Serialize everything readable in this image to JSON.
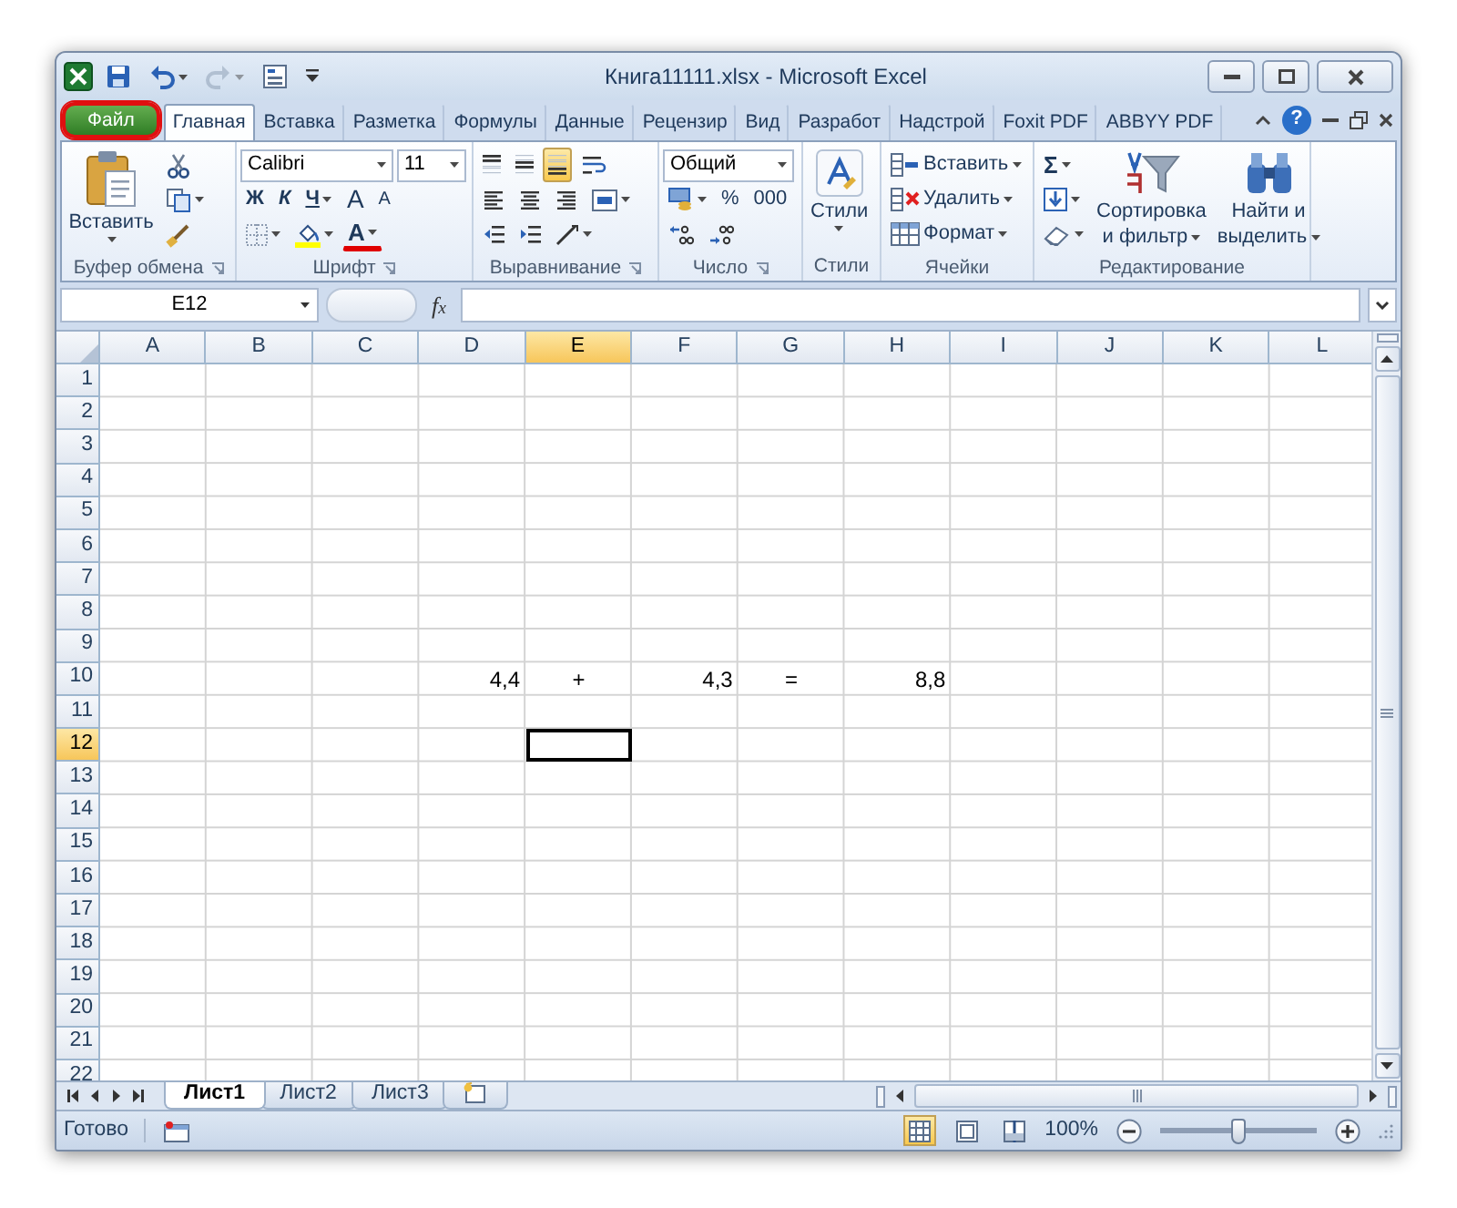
{
  "window": {
    "title": "Книга11111.xlsx - Microsoft Excel"
  },
  "tabs": [
    {
      "label": "Файл",
      "kind": "file",
      "selected": false,
      "circled": true
    },
    {
      "label": "Главная",
      "kind": "tab",
      "selected": true,
      "circled": false
    },
    {
      "label": "Вставка",
      "kind": "tab",
      "selected": false,
      "circled": false
    },
    {
      "label": "Разметка",
      "kind": "tab",
      "selected": false,
      "circled": false
    },
    {
      "label": "Формулы",
      "kind": "tab",
      "selected": false,
      "circled": false
    },
    {
      "label": "Данные",
      "kind": "tab",
      "selected": false,
      "circled": false
    },
    {
      "label": "Рецензир",
      "kind": "tab",
      "selected": false,
      "circled": false
    },
    {
      "label": "Вид",
      "kind": "tab",
      "selected": false,
      "circled": false
    },
    {
      "label": "Разработ",
      "kind": "tab",
      "selected": false,
      "circled": false
    },
    {
      "label": "Надстрой",
      "kind": "tab",
      "selected": false,
      "circled": false
    },
    {
      "label": "Foxit PDF",
      "kind": "tab",
      "selected": false,
      "circled": false
    },
    {
      "label": "ABBYY PDF",
      "kind": "tab",
      "selected": false,
      "circled": false
    }
  ],
  "help": "?",
  "ribbon": {
    "clipboard": {
      "label": "Буфер обмена",
      "paste": "Вставить"
    },
    "font": {
      "label": "Шрифт",
      "name": "Calibri",
      "size": "11",
      "bold": "Ж",
      "italic": "К",
      "underline": "Ч",
      "grow": "A",
      "shrink": "A",
      "color_letter": "A"
    },
    "alignment": {
      "label": "Выравнивание",
      "vertical_buttons": [
        {
          "kind": "top",
          "selected": false
        },
        {
          "kind": "middle",
          "selected": false
        },
        {
          "kind": "bottom",
          "selected": true
        }
      ]
    },
    "number": {
      "label": "Число",
      "format": "Общий",
      "percent": "%",
      "thousands": "000"
    },
    "styles": {
      "button": "Стили",
      "label": "Стили"
    },
    "cells": {
      "label": "Ячейки",
      "buttons": [
        "Вставить",
        "Удалить",
        "Формат"
      ]
    },
    "editing": {
      "label": "Редактирование",
      "sum": "Σ",
      "sort": [
        "Сортировка",
        "и фильтр"
      ],
      "find": [
        "Найти и",
        "выделить"
      ]
    }
  },
  "formula_bar": {
    "name_box": "E12",
    "fx": "f$_{x}$"
  },
  "grid": {
    "columns": [
      {
        "label": "A",
        "selected": false
      },
      {
        "label": "B",
        "selected": false
      },
      {
        "label": "C",
        "selected": false
      },
      {
        "label": "D",
        "selected": false
      },
      {
        "label": "E",
        "selected": true
      },
      {
        "label": "F",
        "selected": false
      },
      {
        "label": "G",
        "selected": false
      },
      {
        "label": "H",
        "selected": false
      },
      {
        "label": "I",
        "selected": false
      },
      {
        "label": "J",
        "selected": false
      },
      {
        "label": "K",
        "selected": false
      },
      {
        "label": "L",
        "selected": false
      }
    ],
    "rows": [
      {
        "label": "1",
        "selected": false
      },
      {
        "label": "2",
        "selected": false
      },
      {
        "label": "3",
        "selected": false
      },
      {
        "label": "4",
        "selected": false
      },
      {
        "label": "5",
        "selected": false
      },
      {
        "label": "6",
        "selected": false
      },
      {
        "label": "7",
        "selected": false
      },
      {
        "label": "8",
        "selected": false
      },
      {
        "label": "9",
        "selected": false
      },
      {
        "label": "10",
        "selected": false,
        "cells": [
          null,
          null,
          null,
          {
            "kind": "number",
            "text": "4,4"
          },
          {
            "kind": "symbol",
            "text": "+"
          },
          {
            "kind": "number",
            "text": "4,3"
          },
          {
            "kind": "symbol",
            "text": "="
          },
          {
            "kind": "number",
            "text": "8,8"
          }
        ]
      },
      {
        "label": "11",
        "selected": false
      },
      {
        "label": "12",
        "selected": true
      },
      {
        "label": "13",
        "selected": false
      },
      {
        "label": "14",
        "selected": false
      },
      {
        "label": "15",
        "selected": false
      },
      {
        "label": "16",
        "selected": false
      },
      {
        "label": "17",
        "selected": false
      },
      {
        "label": "18",
        "selected": false
      },
      {
        "label": "19",
        "selected": false
      },
      {
        "label": "20",
        "selected": false
      },
      {
        "label": "21",
        "selected": false
      },
      {
        "label": "22",
        "selected": false
      }
    ]
  },
  "sheets": [
    {
      "label": "Лист1",
      "selected": true
    },
    {
      "label": "Лист2",
      "selected": false
    },
    {
      "label": "Лист3",
      "selected": false
    }
  ],
  "status_bar": {
    "text": "Готово",
    "views": [
      {
        "kind": "normal",
        "selected": true
      },
      {
        "kind": "page_layout",
        "selected": false
      },
      {
        "kind": "page_break",
        "selected": false
      }
    ],
    "zoom": "100%",
    "level": 0.5
  }
}
